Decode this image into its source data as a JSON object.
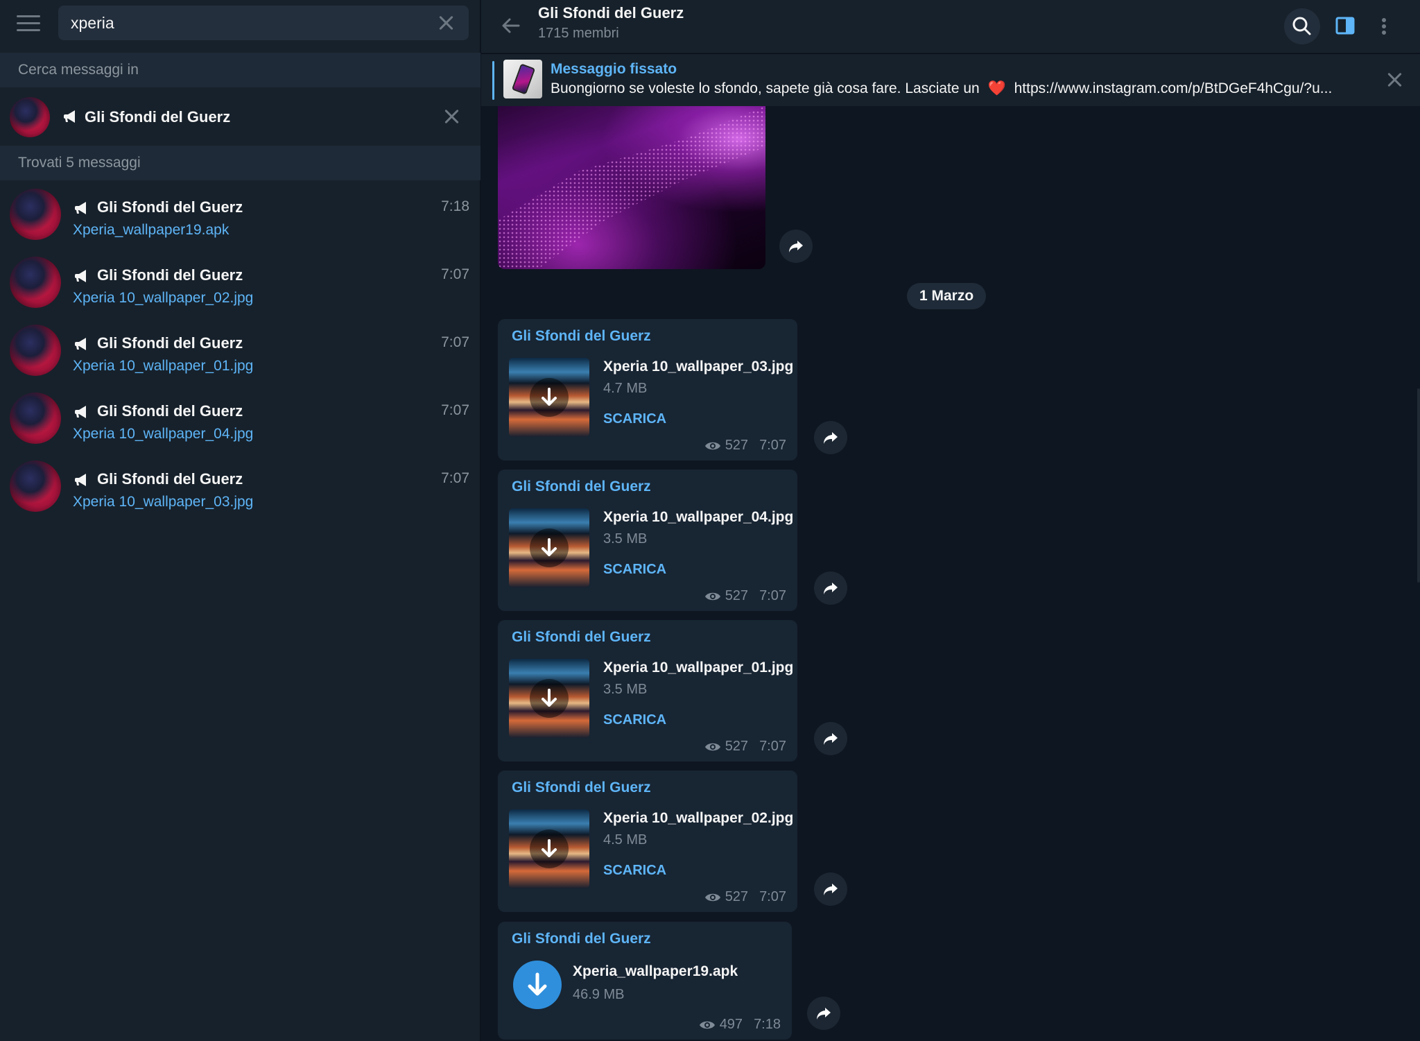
{
  "search": {
    "query": "xperia"
  },
  "left": {
    "search_in_label": "Cerca messaggi in",
    "search_in_channel": "Gli Sfondi del Guerz",
    "found_label": "Trovati 5 messaggi",
    "results": [
      {
        "channel": "Gli Sfondi del Guerz",
        "time": "7:18",
        "snippet": "Xperia_wallpaper19.apk"
      },
      {
        "channel": "Gli Sfondi del Guerz",
        "time": "7:07",
        "snippet": "Xperia 10_wallpaper_02.jpg"
      },
      {
        "channel": "Gli Sfondi del Guerz",
        "time": "7:07",
        "snippet": "Xperia 10_wallpaper_01.jpg"
      },
      {
        "channel": "Gli Sfondi del Guerz",
        "time": "7:07",
        "snippet": "Xperia 10_wallpaper_04.jpg"
      },
      {
        "channel": "Gli Sfondi del Guerz",
        "time": "7:07",
        "snippet": "Xperia 10_wallpaper_03.jpg"
      }
    ]
  },
  "chat": {
    "title": "Gli Sfondi del Guerz",
    "subtitle": "1715 membri",
    "pinned": {
      "title": "Messaggio fissato",
      "text_before": "Buongiorno se voleste lo sfondo, sapete già cosa fare. Lasciate un",
      "heart": "❤️",
      "text_after": "https://www.instagram.com/p/BtDGeF4hCgu/?u..."
    },
    "date_separator": "1 Marzo",
    "messages": [
      {
        "sender": "Gli Sfondi del Guerz",
        "file": "Xperia 10_wallpaper_03.jpg",
        "size": "4.7 MB",
        "action": "SCARICA",
        "views": "527",
        "time": "7:07"
      },
      {
        "sender": "Gli Sfondi del Guerz",
        "file": "Xperia 10_wallpaper_04.jpg",
        "size": "3.5 MB",
        "action": "SCARICA",
        "views": "527",
        "time": "7:07"
      },
      {
        "sender": "Gli Sfondi del Guerz",
        "file": "Xperia 10_wallpaper_01.jpg",
        "size": "3.5 MB",
        "action": "SCARICA",
        "views": "527",
        "time": "7:07"
      },
      {
        "sender": "Gli Sfondi del Guerz",
        "file": "Xperia 10_wallpaper_02.jpg",
        "size": "4.5 MB",
        "action": "SCARICA",
        "views": "527",
        "time": "7:07"
      },
      {
        "sender": "Gli Sfondi del Guerz",
        "file": "Xperia_wallpaper19.apk",
        "size": "46.9 MB",
        "views": "497",
        "time": "7:18"
      }
    ]
  },
  "colors": {
    "accent": "#5eb5f7",
    "background": "#0e1621",
    "panel": "#17212b",
    "bubble": "#182533"
  },
  "icons": [
    "menu-icon",
    "close-icon",
    "megaphone-icon",
    "back-arrow-icon",
    "search-icon",
    "sidebar-toggle-icon",
    "more-vertical-icon",
    "share-icon",
    "download-icon",
    "eye-icon",
    "heart-icon"
  ]
}
